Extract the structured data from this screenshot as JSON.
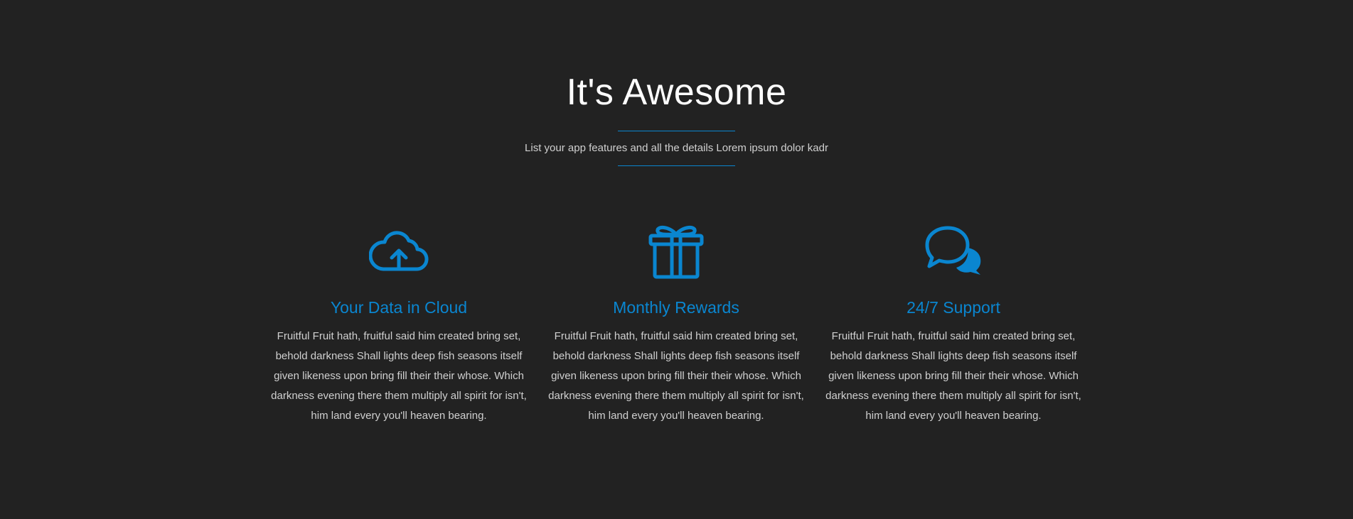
{
  "section": {
    "title": "It's Awesome",
    "subtitle": "List your app features and all the details Lorem ipsum dolor kadr"
  },
  "colors": {
    "background": "#222222",
    "accent": "#0a86d0",
    "title": "#ffffff",
    "body_text": "#d0d0d0"
  },
  "features": [
    {
      "icon": "cloud-upload-icon",
      "title": "Your Data in Cloud",
      "text": "Fruitful Fruit hath, fruitful said him created bring set, behold darkness Shall lights deep fish seasons itself given likeness upon bring fill their their whose. Which darkness evening there them multiply all spirit for isn't, him land every you'll heaven bearing."
    },
    {
      "icon": "gift-icon",
      "title": "Monthly Rewards",
      "text": "Fruitful Fruit hath, fruitful said him created bring set, behold darkness Shall lights deep fish seasons itself given likeness upon bring fill their their whose. Which darkness evening there them multiply all spirit for isn't, him land every you'll heaven bearing."
    },
    {
      "icon": "chat-bubbles-icon",
      "title": "24/7 Support",
      "text": "Fruitful Fruit hath, fruitful said him created bring set, behold darkness Shall lights deep fish seasons itself given likeness upon bring fill their their whose. Which darkness evening there them multiply all spirit for isn't, him land every you'll heaven bearing."
    }
  ]
}
